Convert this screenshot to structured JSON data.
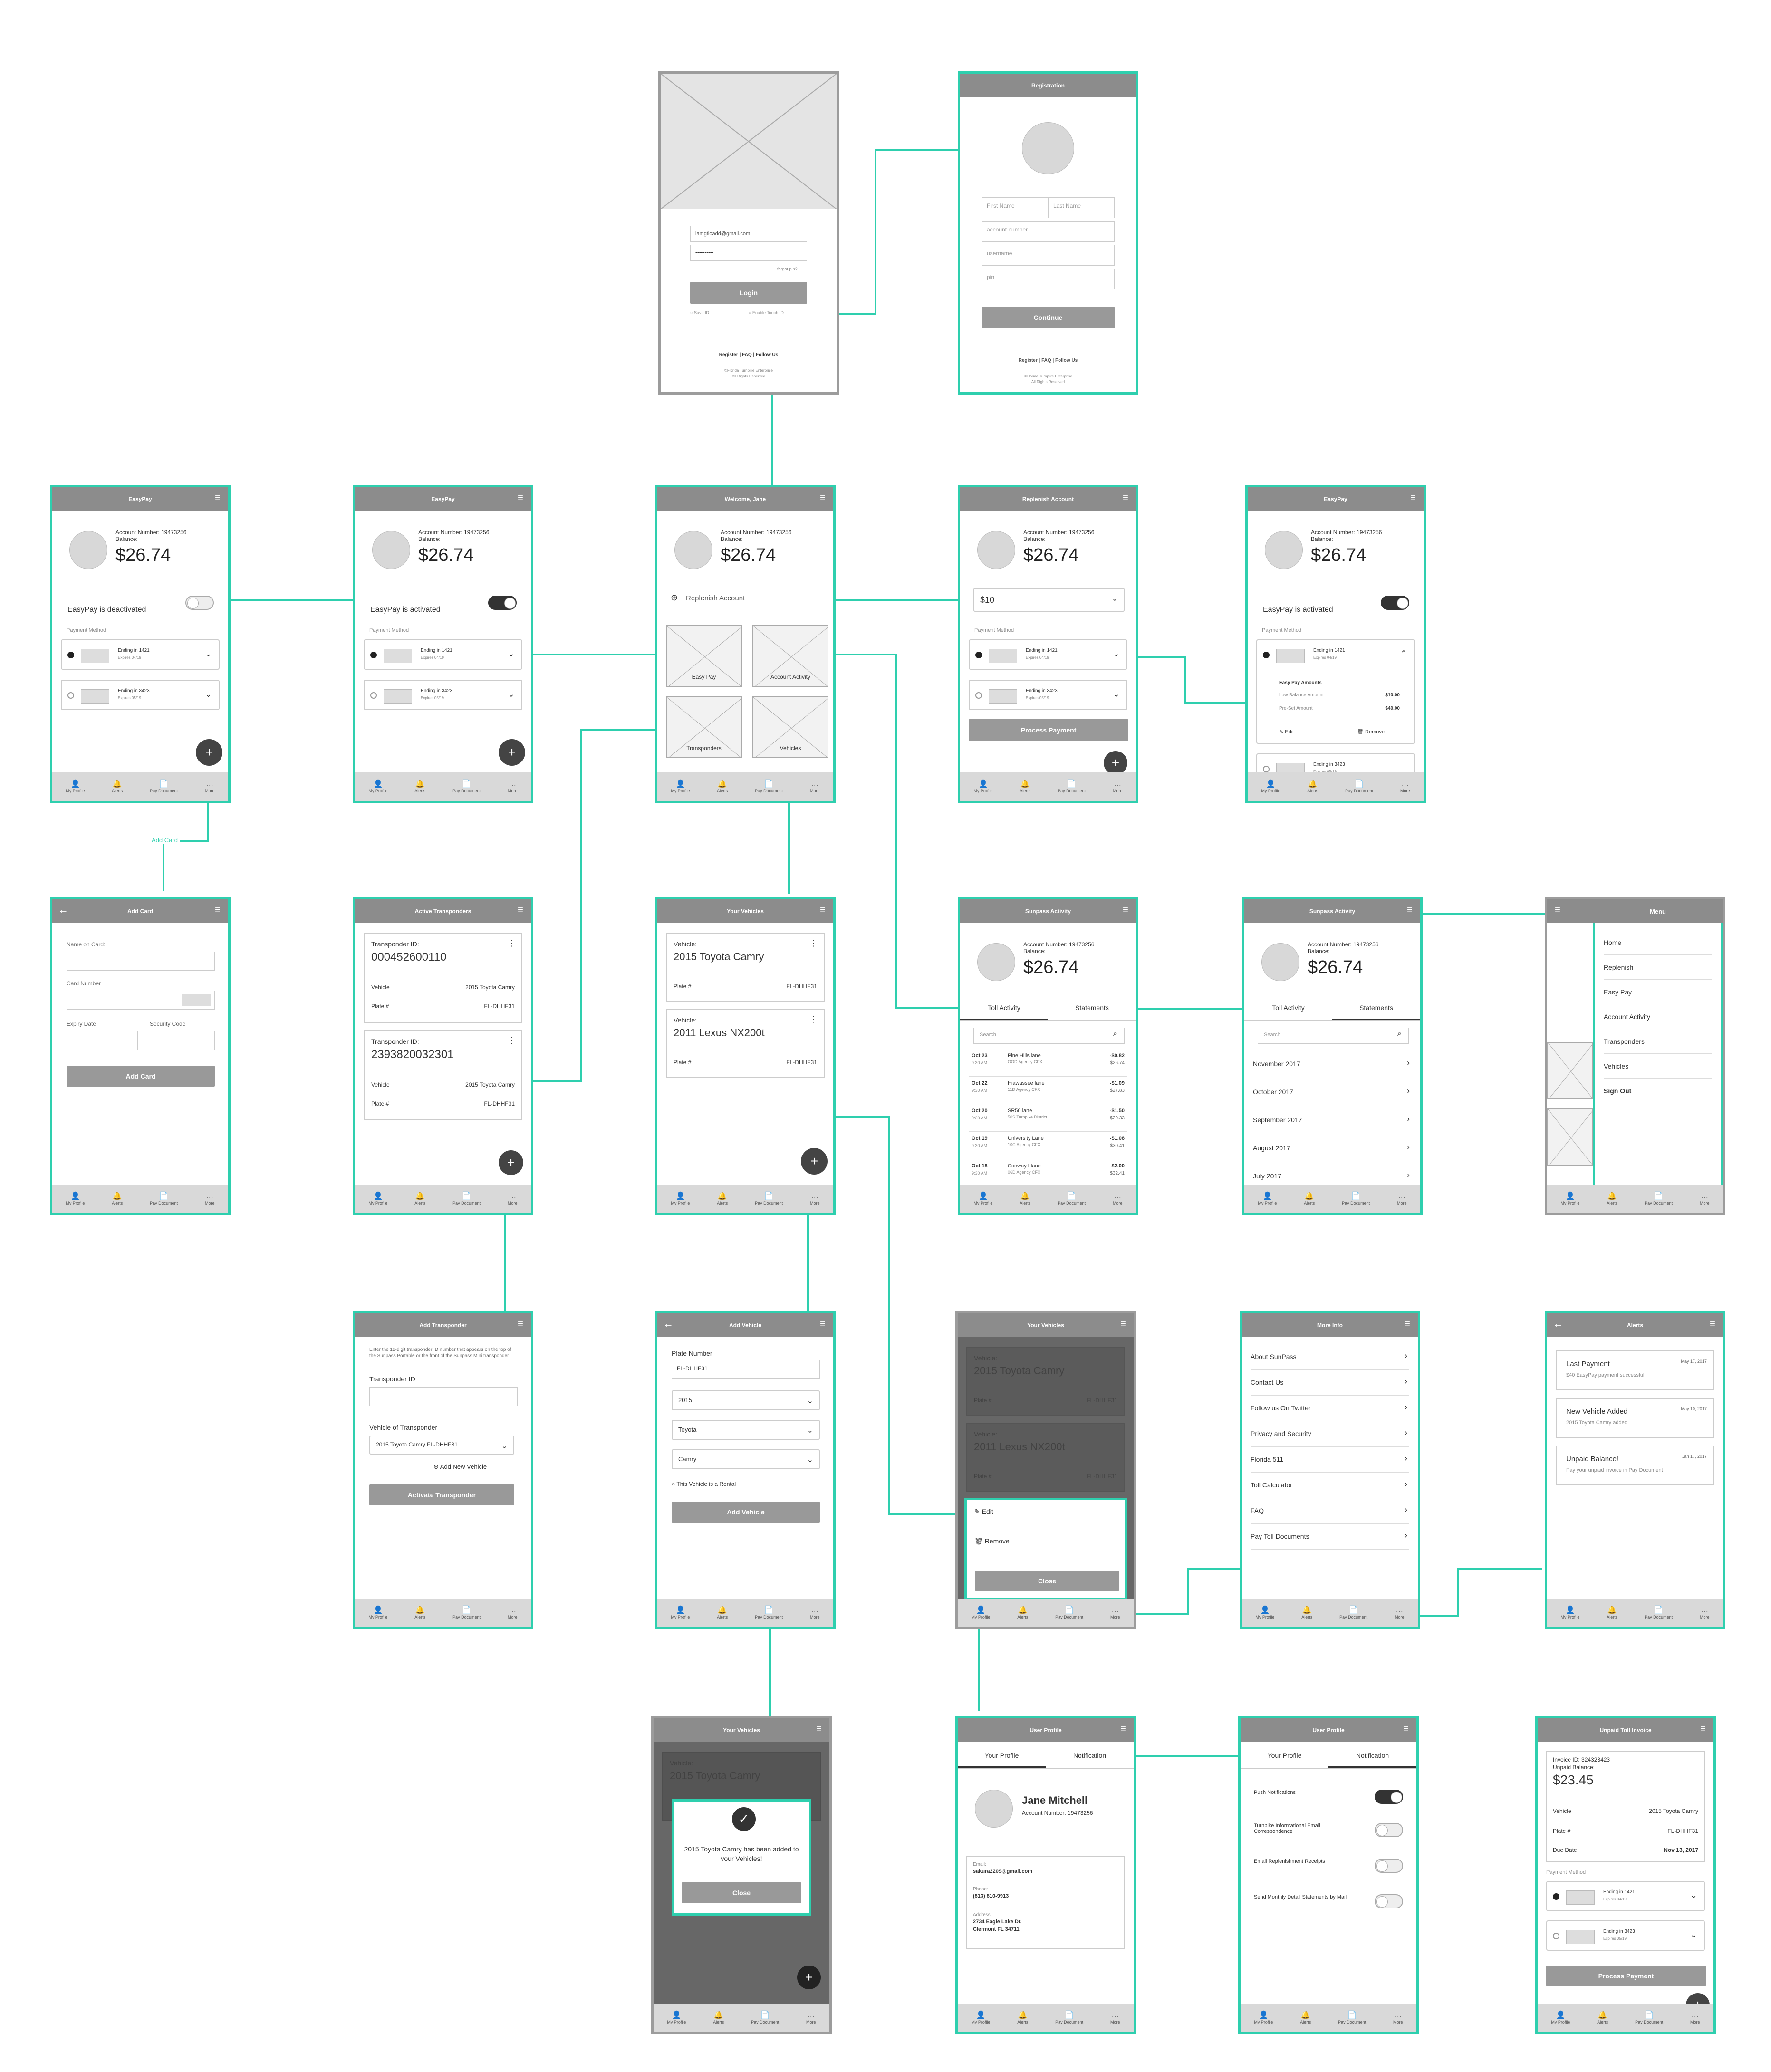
{
  "colors": {
    "accent": "#2ecfae",
    "title_bar": "#8c8c8c",
    "nav_bar": "#d9d9d9",
    "dark": "#444444"
  },
  "nav": [
    "My Profile",
    "Alerts",
    "Pay Document",
    "More"
  ],
  "nav_icons": [
    "person-icon",
    "bell-icon",
    "document-icon",
    "more-icon"
  ],
  "common": {
    "account_number": "Account Number: 19473256",
    "balance_label": "Balance:",
    "balance": "$26.74",
    "payment_method": "Payment Method",
    "card1": "Ending in 1421",
    "card1_exp": "Expires 04/19",
    "card2": "Ending in 3423",
    "card2_exp": "Expires 05/19",
    "links": "Register | FAQ | Follow Us",
    "copyright1": "©Florida Turnpike Enterprise",
    "copyright2": "All Rights Reserved"
  },
  "login": {
    "email": "iamgtloadd@gmail.com",
    "password": "••••••••••",
    "forgot": "forgot pin?",
    "login_button": "Login",
    "save_id": "Save ID",
    "touch_id": "Enable Touch ID"
  },
  "registration": {
    "title": "Registration",
    "first_name": "First Name",
    "last_name": "Last Name",
    "account_number": "account number",
    "username": "username",
    "pin": "pin",
    "continue_button": "Continue"
  },
  "easypay_off": {
    "title": "EasyPay",
    "status": "EasyPay is deactivated"
  },
  "easypay_on": {
    "title": "EasyPay",
    "status": "EasyPay is activated"
  },
  "home": {
    "title": "Welcome, Jane",
    "replenish": "Replenish Account",
    "tiles": [
      "Easy Pay",
      "Account Activity",
      "Transponders",
      "Vehicles"
    ]
  },
  "replenish": {
    "title": "Replenish Account",
    "amount": "$10",
    "process": "Process Payment"
  },
  "easypay_expanded": {
    "title": "EasyPay",
    "status": "EasyPay is activated",
    "amounts_heading": "Easy Pay Amounts",
    "low_label": "Low Balance Amount",
    "low_value": "$10.00",
    "preset_label": "Pre-Set Amount",
    "preset_value": "$40.00",
    "edit": "Edit",
    "remove": "Remove"
  },
  "add_card_link": "Add Card",
  "add_card": {
    "title": "Add Card",
    "name_label": "Name on Card:",
    "number_label": "Card Number",
    "expiry_label": "Expiry Date",
    "security_label": "Security Code",
    "button": "Add Card"
  },
  "transponders": {
    "title": "Active Transponders",
    "id_label": "Transponder ID:",
    "items": [
      {
        "id": "000452600110",
        "vehicle": "2015 Toyota Camry",
        "plate": "FL-DHHF31"
      },
      {
        "id": "2393820032301",
        "vehicle": "2015 Toyota Camry",
        "plate": "FL-DHHF31"
      }
    ],
    "vehicle_label": "Vehicle",
    "plate_label": "Plate #"
  },
  "vehicles": {
    "title": "Your Vehicles",
    "vehicle_label": "Vehicle:",
    "plate_label": "Plate #",
    "items": [
      {
        "name": "2015 Toyota Camry",
        "plate": "FL-DHHF31"
      },
      {
        "name": "2011 Lexus NX200t",
        "plate": "FL-DHHF31"
      }
    ]
  },
  "activity": {
    "title": "Sunpass Activity",
    "tab_toll": "Toll Activity",
    "tab_statements": "Statements",
    "search": "Search",
    "rows": [
      {
        "date": "Oct 23",
        "time": "9:30 AM",
        "place": "Pine Hills lane",
        "agency": "OOD Agency CFX",
        "amount": "-$0.82",
        "bal": "$26.74"
      },
      {
        "date": "Oct 22",
        "time": "9:30 AM",
        "place": "Hiawassee lane",
        "agency": "11D Agency CFX",
        "amount": "-$1.09",
        "bal": "$27.83"
      },
      {
        "date": "Oct 20",
        "time": "9:30 AM",
        "place": "SR50 lane",
        "agency": "50S Turnpike District",
        "amount": "-$1.50",
        "bal": "$29.33"
      },
      {
        "date": "Oct 19",
        "time": "9:30 AM",
        "place": "University Lane",
        "agency": "10C Agency CFX",
        "amount": "-$1.08",
        "bal": "$30.41"
      },
      {
        "date": "Oct 18",
        "time": "9:30 AM",
        "place": "Conway Llane",
        "agency": "06D Agency CFX",
        "amount": "-$2.00",
        "bal": "$32.41"
      }
    ],
    "statements": [
      "November 2017",
      "October 2017",
      "September 2017",
      "August 2017",
      "July 2017"
    ]
  },
  "menu": {
    "title": "Menu",
    "items": [
      "Home",
      "Replenish",
      "Easy Pay",
      "Account Activity",
      "Transponders",
      "Vehicles",
      "Sign Out"
    ]
  },
  "add_transponder": {
    "title": "Add Transponder",
    "intro": "Enter the 12-digit transponder ID number that appears on the top of the Sunpass Portable or the front of the Sunpass Mini transponder",
    "id_label": "Transponder ID",
    "vehicle_label": "Vehicle of Transponder",
    "vehicle_value": "2015 Toyota Camry FL-DHHF31",
    "add_new": "Add New Vehicle",
    "button": "Activate Transponder"
  },
  "add_vehicle": {
    "title": "Add Vehicle",
    "plate_label": "Plate Number",
    "plate": "FL-DHHF31",
    "year": "2015",
    "make": "Toyota",
    "model": "Camry",
    "rental": "This Vehicle is a Rental",
    "button": "Add Vehicle"
  },
  "vehicle_sheet": {
    "edit": "Edit",
    "remove": "Remove",
    "close": "Close"
  },
  "more_info": {
    "title": "More Info",
    "items": [
      "About SunPass",
      "Contact Us",
      "Follow us On Twitter",
      "Privacy and Security",
      "Florida 511",
      "Toll Calculator",
      "FAQ",
      "Pay Toll Documents"
    ]
  },
  "alerts": {
    "title": "Alerts",
    "items": [
      {
        "head": "Last Payment",
        "date": "May 17, 2017",
        "sub": "$40 EasyPay payment successful"
      },
      {
        "head": "New Vehicle Added",
        "date": "May 10, 2017",
        "sub": "2015 Toyota Camry added"
      },
      {
        "head": "Unpaid Balance!",
        "date": "Jan 17, 2017",
        "sub": "Pay your unpaid invoice in Pay Document"
      }
    ]
  },
  "added_dialog": {
    "text": "2015 Toyota Camry has been added to your Vehicles!",
    "close": "Close"
  },
  "user_profile": {
    "title": "User Profile",
    "tab_profile": "Your Profile",
    "tab_notification": "Notification",
    "name": "Jane Mitchell",
    "account": "Account Number: 19473256",
    "email_label": "Email:",
    "email": "sakura2209@gmail.com",
    "phone_label": "Phone:",
    "phone": "(813) 810-9913",
    "address_label": "Address:",
    "address1": "2734 Eagle Lake Dr.",
    "address2": "Clermont FL 34711"
  },
  "notifications": {
    "items": [
      "Push Notifications",
      "Turnpike Informational Email Correspondence",
      "Email Replenishment Receipts",
      "Send Monthly Detail Statements by Mail"
    ]
  },
  "invoice": {
    "title": "Unpaid Toll Invoice",
    "invoice_id": "Invoice ID: 324323423",
    "unpaid_label": "Unpaid Balance:",
    "amount": "$23.45",
    "vehicle_label": "Vehicle",
    "vehicle": "2015 Toyota Camry",
    "plate_label": "Plate #",
    "plate": "FL-DHHF31",
    "due_label": "Due Date",
    "due": "Nov 13, 2017",
    "payment_method": "Payment Method",
    "process": "Process Payment"
  }
}
